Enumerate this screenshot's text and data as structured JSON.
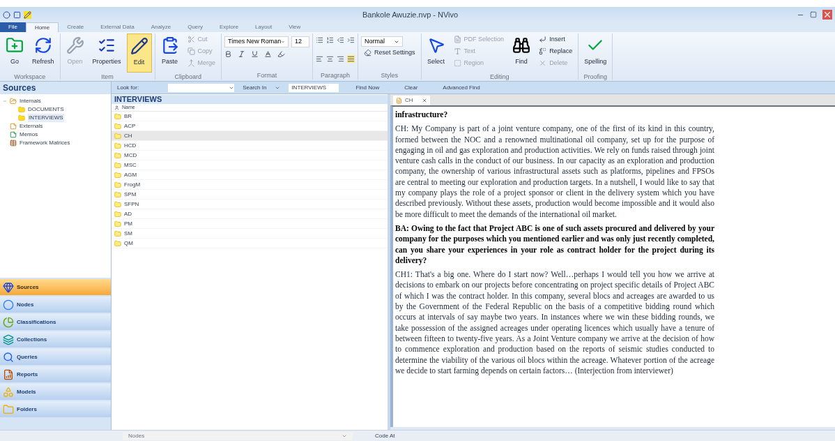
{
  "window": {
    "title": "Bankole Awuzie.nvp - NVivo"
  },
  "ribbon_tabs": [
    {
      "label": "File",
      "selected": false,
      "kind": "file"
    },
    {
      "label": "Home",
      "selected": true,
      "kind": "tab"
    },
    {
      "label": "Create",
      "selected": false,
      "kind": "tab"
    },
    {
      "label": "External Data",
      "selected": false,
      "kind": "tab"
    },
    {
      "label": "Analyze",
      "selected": false,
      "kind": "tab"
    },
    {
      "label": "Query",
      "selected": false,
      "kind": "tab"
    },
    {
      "label": "Explore",
      "selected": false,
      "kind": "tab"
    },
    {
      "label": "Layout",
      "selected": false,
      "kind": "tab"
    },
    {
      "label": "View",
      "selected": false,
      "kind": "tab"
    }
  ],
  "ribbon_groups": [
    {
      "label": "Workspace",
      "items": [
        {
          "kind": "large",
          "label": "Go",
          "disabled": false,
          "on": false
        },
        {
          "kind": "large",
          "label": "Refresh",
          "disabled": false,
          "on": false
        }
      ]
    },
    {
      "label": "Item",
      "items": [
        {
          "kind": "large",
          "label": "Open",
          "disabled": true,
          "on": false
        },
        {
          "kind": "large",
          "label": "Properties",
          "disabled": false,
          "on": false
        },
        {
          "kind": "large",
          "label": "Edit",
          "disabled": false,
          "on": true
        }
      ]
    },
    {
      "label": "Clipboard",
      "items": [
        {
          "kind": "large",
          "label": "Paste",
          "disabled": false,
          "on": false
        },
        {
          "kind": "small",
          "label": "Cut",
          "disabled": true,
          "on": false
        },
        {
          "kind": "small",
          "label": "Copy",
          "disabled": true,
          "on": false
        },
        {
          "kind": "small",
          "label": "Merge",
          "disabled": true,
          "on": false
        }
      ]
    },
    {
      "label": "Format",
      "items": [
        {
          "kind": "font",
          "font": "Times New Roman",
          "size": "12"
        }
      ]
    },
    {
      "label": "Paragraph",
      "items": [
        {
          "kind": "paragraph"
        }
      ]
    },
    {
      "label": "Styles",
      "items": [
        {
          "kind": "style",
          "value": "Normal"
        },
        {
          "kind": "small",
          "label": "Reset Settings",
          "disabled": false,
          "on": false
        }
      ]
    },
    {
      "label": "Editing",
      "items": [
        {
          "kind": "large",
          "label": "Select",
          "disabled": false,
          "on": false
        },
        {
          "kind": "small",
          "label": "PDF Selection",
          "disabled": true,
          "on": false
        },
        {
          "kind": "small",
          "label": "Text",
          "disabled": true,
          "on": false
        },
        {
          "kind": "small",
          "label": "Region",
          "disabled": true,
          "on": false
        },
        {
          "kind": "large",
          "label": "Find",
          "disabled": false,
          "on": false
        },
        {
          "kind": "small",
          "label": "Insert",
          "disabled": false,
          "on": false
        },
        {
          "kind": "small",
          "label": "Replace",
          "disabled": false,
          "on": false
        },
        {
          "kind": "small",
          "label": "Delete",
          "disabled": true,
          "on": false
        }
      ]
    },
    {
      "label": "Proofing",
      "items": [
        {
          "kind": "large",
          "label": "Spelling",
          "disabled": false,
          "on": false
        }
      ]
    }
  ],
  "find_bar": {
    "look_for_label": "Look for:",
    "search_in_label": "Search In",
    "search_in_value": "INTERVIEWS",
    "buttons": [
      "Find Now",
      "Clear",
      "Advanced Find"
    ]
  },
  "sources": {
    "title": "Sources",
    "tree": [
      {
        "label": "Internals",
        "expanded": true,
        "children": [
          {
            "label": "DOCUMENTS",
            "selected": false
          },
          {
            "label": "INTERVIEWS",
            "selected": true
          }
        ]
      },
      {
        "label": "Externals"
      },
      {
        "label": "Memos"
      },
      {
        "label": "Framework Matrices"
      }
    ]
  },
  "navigation": [
    {
      "label": "Sources",
      "selected": true
    },
    {
      "label": "Nodes",
      "selected": false
    },
    {
      "label": "Classifications",
      "selected": false
    },
    {
      "label": "Collections",
      "selected": false
    },
    {
      "label": "Queries",
      "selected": false
    },
    {
      "label": "Reports",
      "selected": false
    },
    {
      "label": "Models",
      "selected": false
    },
    {
      "label": "Folders",
      "selected": false
    }
  ],
  "list": {
    "title": "INTERVIEWS",
    "column": "Name",
    "rows": [
      {
        "name": "BR",
        "selected": false
      },
      {
        "name": "ACP",
        "selected": false
      },
      {
        "name": "CH",
        "selected": true
      },
      {
        "name": "HCD",
        "selected": false
      },
      {
        "name": "MCD",
        "selected": false
      },
      {
        "name": "MSC",
        "selected": false
      },
      {
        "name": "AGM",
        "selected": false
      },
      {
        "name": "FrogM",
        "selected": false
      },
      {
        "name": "SPM",
        "selected": false
      },
      {
        "name": "SFPN",
        "selected": false
      },
      {
        "name": "AD",
        "selected": false
      },
      {
        "name": "PM",
        "selected": false
      },
      {
        "name": "SM",
        "selected": false
      },
      {
        "name": "QM",
        "selected": false
      }
    ]
  },
  "document": {
    "tab": "CH",
    "paragraphs": [
      {
        "kind": "question",
        "text": "infrastructure?"
      },
      {
        "kind": "answer",
        "text": "CH: My Company is part of a joint venture company, one of the first of its kind in this country, formed between the NOC and a renowned multinational oil company, set up for the purpose of engaging in oil and gas exploration and production activities. We rely on funds raised through joint venture cash calls in the conduct of our business. In our capacity as an exploration and production company, the ownership of various infrastructural assets such as platforms, pipelines and FPSOs are central to meeting our exploration and production targets. In a nutshell, I would like to say that my company plays the role of a project sponsor or client in the delivery system which you have described previously. Without these assets, production would become impossible and it would also be more difficult to meet the demands of the international oil market."
      },
      {
        "kind": "question",
        "text": "BA: Owing to the fact that Project ABC is one of such assets procured and delivered by your company for the purposes which you mentioned earlier and was only just recently completed, can you share your experiences in your role as contract holder for the project during its delivery?"
      },
      {
        "kind": "answer",
        "text": "CH1: That's a big one. Where do I start now? Well…perhaps I would tell you how we arrive at decisions to embark on our projects before concentrating on project specific details of Project ABC of which I was the contract holder. In this company, several blocs and acreages are awarded to us by the Government of the Federal Republic on the basis of a competitive bidding round which occurs at intervals of say maybe two years. In instances where we win these bidding rounds, we take possession of the assigned acreages under operating licences which usually have a tenure of between fifteen to twenty-five years. As a Joint Venture company we arrive at the decision of how to commence exploration and production based on the reports of seismic studies conducted to determine the viability of the various oil blocs within the acreage. Whatever portion of the acreage we decide to start farming depends on certain factors… (Interjection from interviewer)"
      }
    ]
  },
  "status_bar": {
    "nodes_placeholder": "Nodes",
    "code_at": "Code At"
  }
}
